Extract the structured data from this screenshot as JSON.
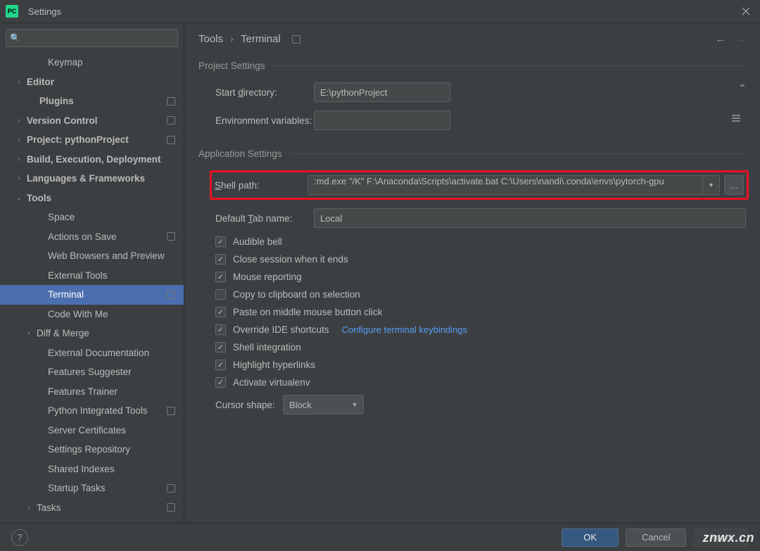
{
  "window": {
    "title": "Settings"
  },
  "breadcrumb": {
    "root": "Tools",
    "leaf": "Terminal"
  },
  "sidebar": {
    "items": [
      {
        "label": "Keymap",
        "caret": "",
        "bold": false,
        "sub": true,
        "dot": false
      },
      {
        "label": "Editor",
        "caret": "›",
        "bold": true,
        "sub": false,
        "dot": false
      },
      {
        "label": "Plugins",
        "caret": "",
        "bold": true,
        "sub": false,
        "dot": true,
        "pad": true
      },
      {
        "label": "Version Control",
        "caret": "›",
        "bold": true,
        "sub": false,
        "dot": true
      },
      {
        "label": "Project: pythonProject",
        "caret": "›",
        "bold": true,
        "sub": false,
        "dot": true
      },
      {
        "label": "Build, Execution, Deployment",
        "caret": "›",
        "bold": true,
        "sub": false,
        "dot": false
      },
      {
        "label": "Languages & Frameworks",
        "caret": "›",
        "bold": true,
        "sub": false,
        "dot": false
      },
      {
        "label": "Tools",
        "caret": "⌄",
        "bold": true,
        "sub": false,
        "dot": false
      },
      {
        "label": "Space",
        "caret": "",
        "bold": false,
        "sub": true,
        "dot": false
      },
      {
        "label": "Actions on Save",
        "caret": "",
        "bold": false,
        "sub": true,
        "dot": true
      },
      {
        "label": "Web Browsers and Preview",
        "caret": "",
        "bold": false,
        "sub": true,
        "dot": false
      },
      {
        "label": "External Tools",
        "caret": "",
        "bold": false,
        "sub": true,
        "dot": false
      },
      {
        "label": "Terminal",
        "caret": "",
        "bold": false,
        "sub": true,
        "dot": true,
        "selected": true
      },
      {
        "label": "Code With Me",
        "caret": "",
        "bold": false,
        "sub": true,
        "dot": false
      },
      {
        "label": "Diff & Merge",
        "caret": "›",
        "bold": false,
        "sub": true,
        "dot": false,
        "caretsub": true
      },
      {
        "label": "External Documentation",
        "caret": "",
        "bold": false,
        "sub": true,
        "dot": false
      },
      {
        "label": "Features Suggester",
        "caret": "",
        "bold": false,
        "sub": true,
        "dot": false
      },
      {
        "label": "Features Trainer",
        "caret": "",
        "bold": false,
        "sub": true,
        "dot": false
      },
      {
        "label": "Python Integrated Tools",
        "caret": "",
        "bold": false,
        "sub": true,
        "dot": true
      },
      {
        "label": "Server Certificates",
        "caret": "",
        "bold": false,
        "sub": true,
        "dot": false
      },
      {
        "label": "Settings Repository",
        "caret": "",
        "bold": false,
        "sub": true,
        "dot": false
      },
      {
        "label": "Shared Indexes",
        "caret": "",
        "bold": false,
        "sub": true,
        "dot": false
      },
      {
        "label": "Startup Tasks",
        "caret": "",
        "bold": false,
        "sub": true,
        "dot": true
      },
      {
        "label": "Tasks",
        "caret": "›",
        "bold": false,
        "sub": true,
        "dot": true,
        "caretsub": true
      }
    ]
  },
  "sections": {
    "project": "Project Settings",
    "application": "Application Settings"
  },
  "form": {
    "start_dir_label_pre": "Start ",
    "start_dir_label_ul": "d",
    "start_dir_label_post": "irectory:",
    "start_dir_value": "E:\\pythonProject",
    "env_label": "Environment variables:",
    "env_value": "",
    "shell_label_ul": "S",
    "shell_label_post": "hell path:",
    "shell_value": ":md.exe \"/K\" F:\\Anaconda\\Scripts\\activate.bat C:\\Users\\nandi\\.conda\\envs\\pytorch-gpu",
    "tab_label_pre": "Default ",
    "tab_label_ul": "T",
    "tab_label_post": "ab name:",
    "tab_value": "Local",
    "cursor_label": "Cursor shape:",
    "cursor_value": "Block"
  },
  "checks": [
    {
      "label": "Audible bell",
      "checked": true
    },
    {
      "label": "Close session when it ends",
      "checked": true
    },
    {
      "label": "Mouse reporting",
      "checked": true
    },
    {
      "label": "Copy to clipboard on selection",
      "checked": false
    },
    {
      "label": "Paste on middle mouse button click",
      "checked": true
    },
    {
      "label": "Override IDE shortcuts",
      "checked": true,
      "link": "Configure terminal keybindings"
    },
    {
      "label": "Shell integration",
      "checked": true
    },
    {
      "label": "Highlight hyperlinks",
      "checked": true
    },
    {
      "label": "Activate virtualenv",
      "checked": true
    }
  ],
  "footer": {
    "ok": "OK",
    "cancel": "Cancel",
    "apply": "Apply"
  },
  "watermark": "znwx.cn"
}
